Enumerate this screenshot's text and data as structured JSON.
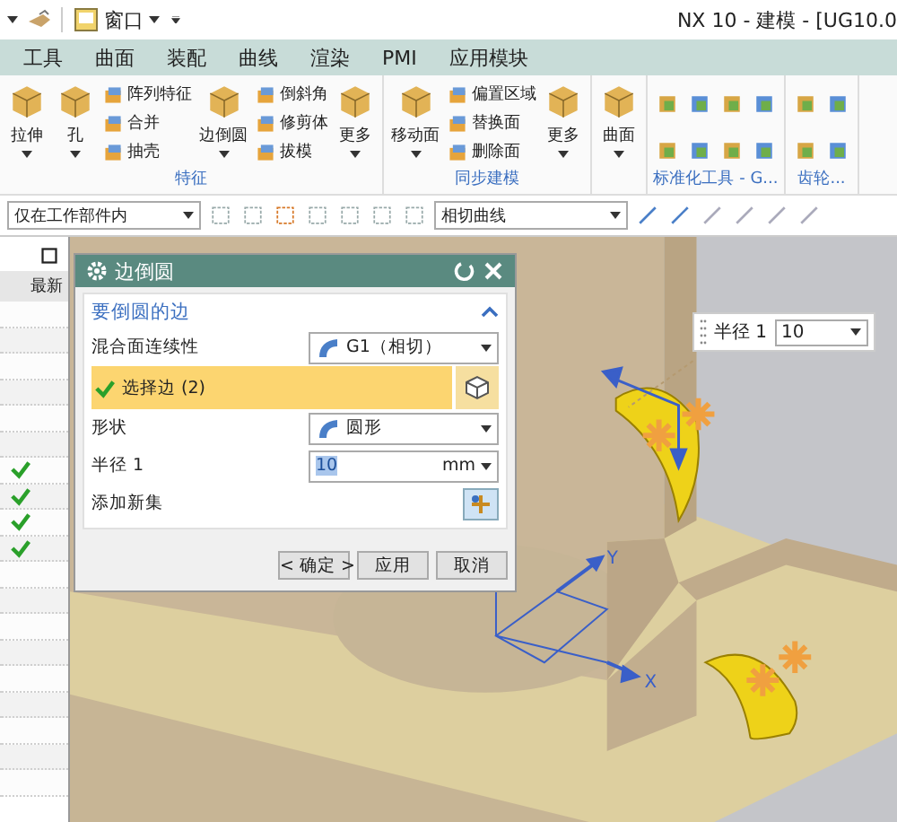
{
  "title_bar": {
    "menu": "窗口",
    "title": "NX 10 - 建模 - [UG10.0"
  },
  "menu_tabs": [
    {
      "label": "工具",
      "selected": false
    },
    {
      "label": "曲面",
      "selected": false
    },
    {
      "label": "装配",
      "selected": false
    },
    {
      "label": "曲线",
      "selected": false
    },
    {
      "label": "渲染",
      "selected": false
    },
    {
      "label": "PMI",
      "selected": false
    },
    {
      "label": "应用模块",
      "selected": false
    }
  ],
  "ribbon_groups": [
    {
      "label": "特征",
      "items": [
        {
          "kind": "large",
          "label": "拉伸"
        },
        {
          "kind": "large",
          "label": "孔"
        },
        {
          "kind": "stack",
          "items": [
            "阵列特征",
            "合并",
            "抽壳"
          ]
        },
        {
          "kind": "large",
          "label": "边倒圆"
        },
        {
          "kind": "stack",
          "items": [
            "倒斜角",
            "修剪体",
            "拔模"
          ]
        },
        {
          "kind": "large",
          "label": "更多"
        }
      ]
    },
    {
      "label": "同步建模",
      "items": [
        {
          "kind": "large",
          "label": "移动面"
        },
        {
          "kind": "stack",
          "items": [
            "偏置区域",
            "替换面",
            "删除面"
          ]
        },
        {
          "kind": "large",
          "label": "更多"
        }
      ]
    },
    {
      "items": [
        {
          "kind": "large",
          "label": "曲面"
        }
      ]
    },
    {
      "label": "标准化工具 - G...",
      "items": [
        {
          "kind": "grid"
        }
      ]
    },
    {
      "label": "齿轮...",
      "items": [
        {
          "kind": "grid2"
        }
      ]
    }
  ],
  "toolbar": {
    "filter": "仅在工作部件内",
    "curve_rule": "相切曲线"
  },
  "part_navigator": {
    "column": "最新",
    "rows": [
      {
        "checked": false
      },
      {
        "checked": false
      },
      {
        "checked": false
      },
      {
        "checked": false
      },
      {
        "checked": false
      },
      {
        "checked": false
      },
      {
        "checked": true
      },
      {
        "checked": true
      },
      {
        "checked": true
      },
      {
        "checked": true
      },
      {
        "checked": false
      },
      {
        "checked": false
      },
      {
        "checked": false
      },
      {
        "checked": false
      },
      {
        "checked": false
      },
      {
        "checked": false
      },
      {
        "checked": false
      },
      {
        "checked": false
      },
      {
        "checked": false
      }
    ]
  },
  "dialog": {
    "title": "边倒圆",
    "section": "要倒圆的边",
    "expanded": true,
    "rows": [
      {
        "kind": "dropdown",
        "label": "混合面连续性",
        "value": "G1（相切）"
      },
      {
        "kind": "select",
        "label": "选择边 (2)",
        "done": true
      },
      {
        "kind": "dropdown",
        "label": "形状",
        "value": "圆形"
      },
      {
        "kind": "number",
        "label": "半径 1",
        "value": "10",
        "unit": "mm"
      },
      {
        "kind": "add",
        "label": "添加新集"
      }
    ],
    "buttons": [
      "< 确定 >",
      "应用",
      "取消"
    ]
  },
  "floating_input": {
    "label": "半径 1",
    "value": "10"
  },
  "axes": {
    "x": "X",
    "y": "Y"
  }
}
